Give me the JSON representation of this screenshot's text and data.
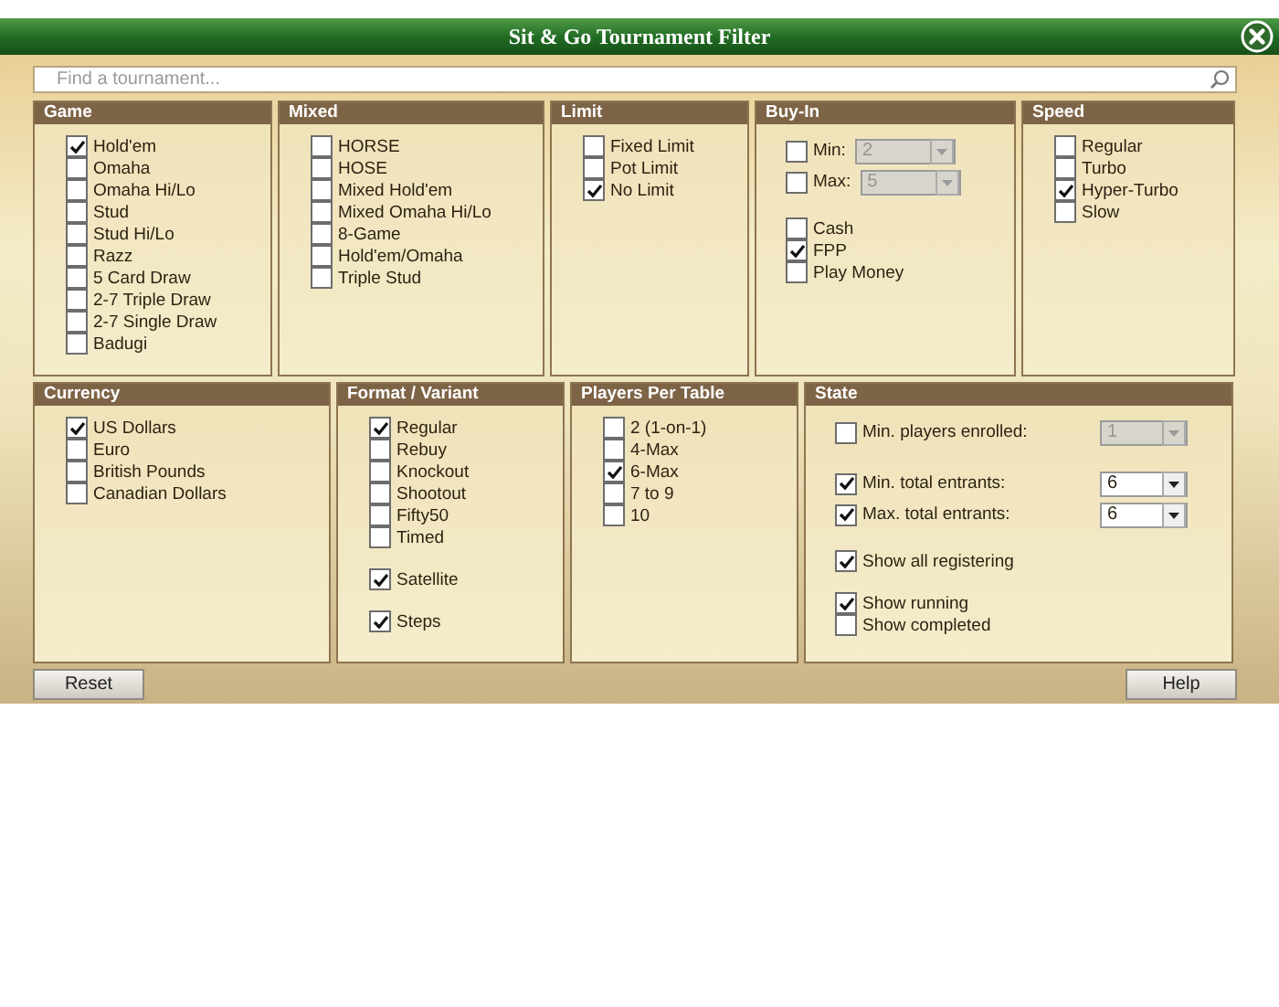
{
  "window": {
    "title": "Sit & Go Tournament Filter"
  },
  "search": {
    "placeholder": "Find a tournament..."
  },
  "top_panels": [
    {
      "title": "Game",
      "groups": [
        [
          {
            "label": "Hold'em",
            "checked": true
          },
          {
            "label": "Omaha",
            "checked": false
          },
          {
            "label": "Omaha Hi/Lo",
            "checked": false
          },
          {
            "label": "Stud",
            "checked": false
          },
          {
            "label": "Stud Hi/Lo",
            "checked": false
          },
          {
            "label": "Razz",
            "checked": false
          },
          {
            "label": "5 Card Draw",
            "checked": false
          },
          {
            "label": "2-7 Triple Draw",
            "checked": false
          },
          {
            "label": "2-7 Single Draw",
            "checked": false
          },
          {
            "label": "Badugi",
            "checked": false
          }
        ]
      ]
    },
    {
      "title": "Mixed",
      "groups": [
        [
          {
            "label": "HORSE",
            "checked": false
          },
          {
            "label": "HOSE",
            "checked": false
          },
          {
            "label": "Mixed Hold'em",
            "checked": false
          },
          {
            "label": "Mixed Omaha Hi/Lo",
            "checked": false
          },
          {
            "label": "8-Game",
            "checked": false
          },
          {
            "label": "Hold'em/Omaha",
            "checked": false
          },
          {
            "label": "Triple Stud",
            "checked": false
          }
        ]
      ]
    },
    {
      "title": "Limit",
      "groups": [
        [
          {
            "label": "Fixed Limit",
            "checked": false
          },
          {
            "label": "Pot Limit",
            "checked": false
          },
          {
            "label": "No Limit",
            "checked": true
          }
        ]
      ]
    },
    {
      "title": "Buy-In",
      "groups": [
        [
          {
            "label": "Min:",
            "checked": false,
            "dropdown": {
              "value": "2",
              "disabled": true
            }
          },
          {
            "label": "Max:",
            "checked": false,
            "dropdown": {
              "value": "5",
              "disabled": true
            }
          }
        ],
        [
          {
            "label": "Cash",
            "checked": false
          },
          {
            "label": "FPP",
            "checked": true
          },
          {
            "label": "Play Money",
            "checked": false
          }
        ]
      ]
    },
    {
      "title": "Speed",
      "groups": [
        [
          {
            "label": "Regular",
            "checked": false
          },
          {
            "label": "Turbo",
            "checked": false
          },
          {
            "label": "Hyper-Turbo",
            "checked": true
          },
          {
            "label": "Slow",
            "checked": false
          }
        ]
      ]
    }
  ],
  "bottom_panels": [
    {
      "title": "Currency",
      "groups": [
        [
          {
            "label": "US Dollars",
            "checked": true
          },
          {
            "label": "Euro",
            "checked": false
          },
          {
            "label": "British Pounds",
            "checked": false
          },
          {
            "label": "Canadian Dollars",
            "checked": false
          }
        ]
      ]
    },
    {
      "title": "Format / Variant",
      "groups": [
        [
          {
            "label": "Regular",
            "checked": true
          },
          {
            "label": "Rebuy",
            "checked": false
          },
          {
            "label": "Knockout",
            "checked": false
          },
          {
            "label": "Shootout",
            "checked": false
          },
          {
            "label": "Fifty50",
            "checked": false
          },
          {
            "label": "Timed",
            "checked": false
          }
        ],
        [
          {
            "label": "Satellite",
            "checked": true
          }
        ],
        [
          {
            "label": "Steps",
            "checked": true
          }
        ]
      ]
    },
    {
      "title": "Players Per Table",
      "groups": [
        [
          {
            "label": "2 (1-on-1)",
            "checked": false
          },
          {
            "label": "4-Max",
            "checked": false
          },
          {
            "label": "6-Max",
            "checked": true
          },
          {
            "label": "7 to 9",
            "checked": false
          },
          {
            "label": "10",
            "checked": false
          }
        ]
      ]
    },
    {
      "title": "State",
      "groups": [
        [
          {
            "label": "Min. players enrolled:",
            "checked": false,
            "dropdown": {
              "value": "1",
              "disabled": true
            }
          }
        ],
        [
          {
            "label": "Min. total entrants:",
            "checked": true,
            "dropdown": {
              "value": "6",
              "disabled": false
            }
          },
          {
            "label": "Max. total entrants:",
            "checked": true,
            "dropdown": {
              "value": "6",
              "disabled": false
            }
          }
        ],
        [
          {
            "label": "Show all registering",
            "checked": true
          }
        ],
        [
          {
            "label": "Show running",
            "checked": true
          },
          {
            "label": "Show completed",
            "checked": false
          }
        ]
      ]
    }
  ],
  "buttons": [
    {
      "label": "Reset"
    },
    {
      "label": "Help"
    }
  ]
}
